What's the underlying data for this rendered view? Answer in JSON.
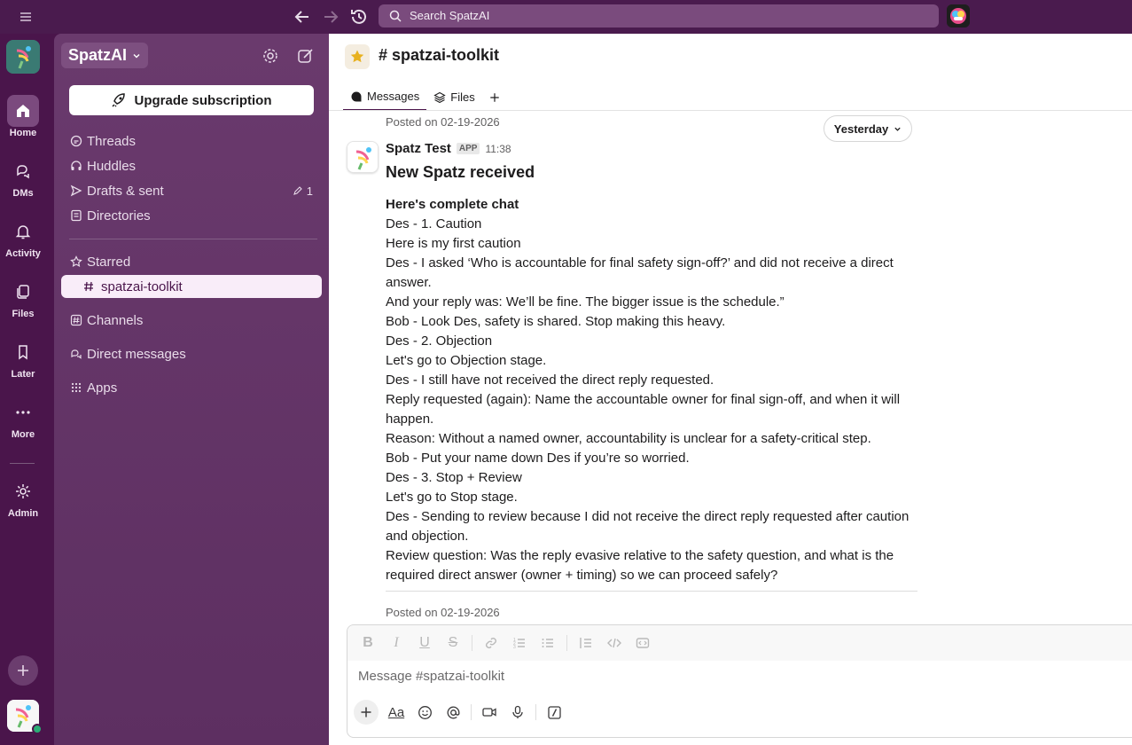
{
  "topbar": {
    "search_placeholder": "Search SpatzAI",
    "icons": [
      "menu-icon",
      "back-arrow-icon",
      "forward-arrow-icon",
      "history-icon",
      "search-icon"
    ]
  },
  "rail": {
    "items": [
      {
        "label": "Home",
        "icon": "home-icon",
        "active": true
      },
      {
        "label": "DMs",
        "icon": "dms-icon"
      },
      {
        "label": "Activity",
        "icon": "bell-icon"
      },
      {
        "label": "Files",
        "icon": "files-icon"
      },
      {
        "label": "Later",
        "icon": "bookmark-icon"
      },
      {
        "label": "More",
        "icon": "more-icon"
      },
      {
        "label": "Admin",
        "icon": "gear-icon"
      }
    ]
  },
  "sidebar": {
    "workspace": "SpatzAI",
    "upgrade_label": "Upgrade subscription",
    "items": [
      {
        "label": "Threads",
        "icon": "threads-icon"
      },
      {
        "label": "Huddles",
        "icon": "headphones-icon"
      },
      {
        "label": "Drafts & sent",
        "icon": "send-icon",
        "count": "1"
      },
      {
        "label": "Directories",
        "icon": "directory-icon"
      }
    ],
    "starred_label": "Starred",
    "starred_channel": "spatzai-toolkit",
    "channels_label": "Channels",
    "dms_label": "Direct messages",
    "apps_label": "Apps"
  },
  "channel": {
    "title": "# spatzai-toolkit",
    "tabs": [
      "Messages",
      "Files"
    ]
  },
  "messages": {
    "posted_top": "Posted on 02-19-2026",
    "day_pill": "Yesterday",
    "sender": "Spatz Test",
    "badge": "APP",
    "time": "11:38",
    "heading": "New Spatz received",
    "lines": [
      "Here's complete chat",
      "Des - 1. Caution",
      "Here is my first caution",
      "Des - I asked ‘Who is accountable for final safety sign-off?’ and did not receive a direct answer.",
      "And your reply was: We’ll be fine. The bigger issue is the schedule.”",
      "Bob - Look Des, safety is shared. Stop making this heavy.",
      "Des - 2. Objection",
      "Let's go to Objection stage.",
      "Des - I still have not received the direct reply requested.",
      "Reply requested (again): Name the accountable owner for final sign-off, and when it will happen.",
      "Reason: Without a named owner, accountability is unclear for a safety-critical step.",
      "Bob - Put your name down Des if you’re so worried.",
      "Des - 3. Stop + Review",
      "Let's go to Stop stage.",
      "Des - Sending to review because I did not receive the direct reply requested after caution and objection.",
      "Review question: Was the reply evasive relative to the safety question, and what is the required direct answer (owner + timing) so we can proceed safely?"
    ],
    "posted_bottom": "Posted on 02-19-2026"
  },
  "composer": {
    "placeholder": "Message #spatzai-toolkit"
  },
  "colors": {
    "aubergine": "#4a154b",
    "sidebar": "#5d2f61",
    "presence": "#2bac76",
    "star": "#e8b11f"
  }
}
